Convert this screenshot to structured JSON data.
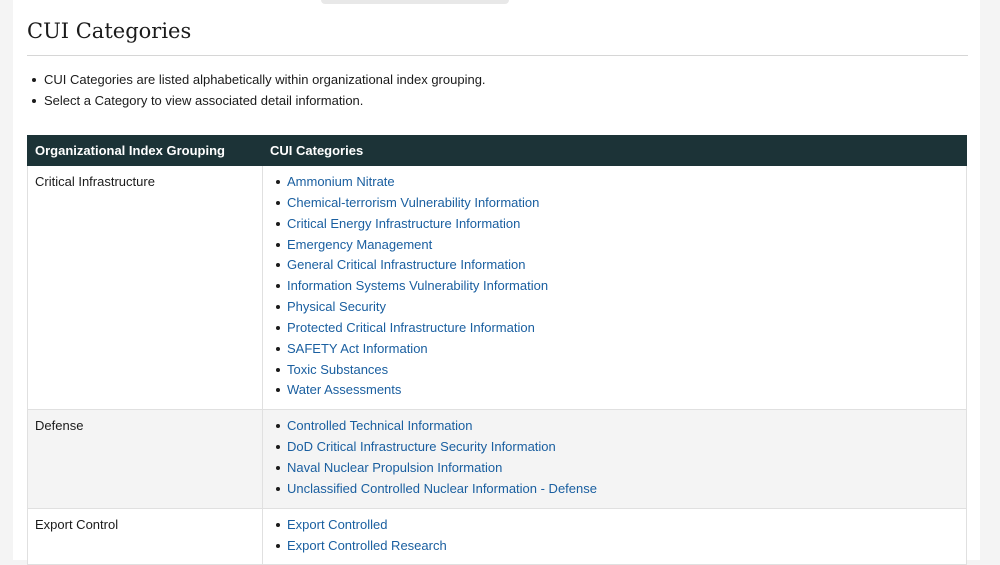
{
  "page": {
    "title": "CUI Categories",
    "notes": [
      "CUI Categories are listed alphabetically within organizational index grouping.",
      "Select a Category to view associated detail information."
    ]
  },
  "table": {
    "headers": [
      "Organizational Index Grouping",
      "CUI Categories"
    ],
    "rows": [
      {
        "group": "Critical Infrastructure",
        "categories": [
          "Ammonium Nitrate",
          "Chemical-terrorism Vulnerability Information",
          "Critical Energy Infrastructure Information",
          "Emergency Management",
          "General Critical Infrastructure Information",
          "Information Systems Vulnerability Information",
          "Physical Security",
          "Protected Critical Infrastructure Information",
          "SAFETY Act Information",
          "Toxic Substances",
          "Water Assessments"
        ]
      },
      {
        "group": "Defense",
        "categories": [
          "Controlled Technical Information",
          "DoD Critical Infrastructure Security Information",
          "Naval Nuclear Propulsion Information",
          "Unclassified Controlled Nuclear Information - Defense"
        ]
      },
      {
        "group": "Export Control",
        "categories": [
          "Export Controlled",
          "Export Controlled Research"
        ]
      }
    ]
  },
  "colors": {
    "header_bg": "#1c3337",
    "link": "#1a5fa0",
    "stripe": "#f4f4f4"
  }
}
